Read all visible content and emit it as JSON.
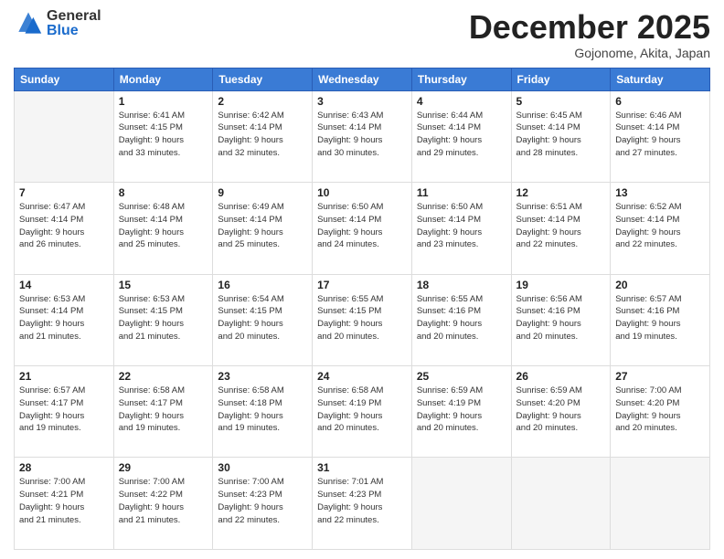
{
  "header": {
    "logo_general": "General",
    "logo_blue": "Blue",
    "month_title": "December 2025",
    "location": "Gojonome, Akita, Japan"
  },
  "days_of_week": [
    "Sunday",
    "Monday",
    "Tuesday",
    "Wednesday",
    "Thursday",
    "Friday",
    "Saturday"
  ],
  "weeks": [
    [
      {
        "day": "",
        "info": []
      },
      {
        "day": "1",
        "info": [
          "Sunrise: 6:41 AM",
          "Sunset: 4:15 PM",
          "Daylight: 9 hours",
          "and 33 minutes."
        ]
      },
      {
        "day": "2",
        "info": [
          "Sunrise: 6:42 AM",
          "Sunset: 4:14 PM",
          "Daylight: 9 hours",
          "and 32 minutes."
        ]
      },
      {
        "day": "3",
        "info": [
          "Sunrise: 6:43 AM",
          "Sunset: 4:14 PM",
          "Daylight: 9 hours",
          "and 30 minutes."
        ]
      },
      {
        "day": "4",
        "info": [
          "Sunrise: 6:44 AM",
          "Sunset: 4:14 PM",
          "Daylight: 9 hours",
          "and 29 minutes."
        ]
      },
      {
        "day": "5",
        "info": [
          "Sunrise: 6:45 AM",
          "Sunset: 4:14 PM",
          "Daylight: 9 hours",
          "and 28 minutes."
        ]
      },
      {
        "day": "6",
        "info": [
          "Sunrise: 6:46 AM",
          "Sunset: 4:14 PM",
          "Daylight: 9 hours",
          "and 27 minutes."
        ]
      }
    ],
    [
      {
        "day": "7",
        "info": [
          "Sunrise: 6:47 AM",
          "Sunset: 4:14 PM",
          "Daylight: 9 hours",
          "and 26 minutes."
        ]
      },
      {
        "day": "8",
        "info": [
          "Sunrise: 6:48 AM",
          "Sunset: 4:14 PM",
          "Daylight: 9 hours",
          "and 25 minutes."
        ]
      },
      {
        "day": "9",
        "info": [
          "Sunrise: 6:49 AM",
          "Sunset: 4:14 PM",
          "Daylight: 9 hours",
          "and 25 minutes."
        ]
      },
      {
        "day": "10",
        "info": [
          "Sunrise: 6:50 AM",
          "Sunset: 4:14 PM",
          "Daylight: 9 hours",
          "and 24 minutes."
        ]
      },
      {
        "day": "11",
        "info": [
          "Sunrise: 6:50 AM",
          "Sunset: 4:14 PM",
          "Daylight: 9 hours",
          "and 23 minutes."
        ]
      },
      {
        "day": "12",
        "info": [
          "Sunrise: 6:51 AM",
          "Sunset: 4:14 PM",
          "Daylight: 9 hours",
          "and 22 minutes."
        ]
      },
      {
        "day": "13",
        "info": [
          "Sunrise: 6:52 AM",
          "Sunset: 4:14 PM",
          "Daylight: 9 hours",
          "and 22 minutes."
        ]
      }
    ],
    [
      {
        "day": "14",
        "info": [
          "Sunrise: 6:53 AM",
          "Sunset: 4:14 PM",
          "Daylight: 9 hours",
          "and 21 minutes."
        ]
      },
      {
        "day": "15",
        "info": [
          "Sunrise: 6:53 AM",
          "Sunset: 4:15 PM",
          "Daylight: 9 hours",
          "and 21 minutes."
        ]
      },
      {
        "day": "16",
        "info": [
          "Sunrise: 6:54 AM",
          "Sunset: 4:15 PM",
          "Daylight: 9 hours",
          "and 20 minutes."
        ]
      },
      {
        "day": "17",
        "info": [
          "Sunrise: 6:55 AM",
          "Sunset: 4:15 PM",
          "Daylight: 9 hours",
          "and 20 minutes."
        ]
      },
      {
        "day": "18",
        "info": [
          "Sunrise: 6:55 AM",
          "Sunset: 4:16 PM",
          "Daylight: 9 hours",
          "and 20 minutes."
        ]
      },
      {
        "day": "19",
        "info": [
          "Sunrise: 6:56 AM",
          "Sunset: 4:16 PM",
          "Daylight: 9 hours",
          "and 20 minutes."
        ]
      },
      {
        "day": "20",
        "info": [
          "Sunrise: 6:57 AM",
          "Sunset: 4:16 PM",
          "Daylight: 9 hours",
          "and 19 minutes."
        ]
      }
    ],
    [
      {
        "day": "21",
        "info": [
          "Sunrise: 6:57 AM",
          "Sunset: 4:17 PM",
          "Daylight: 9 hours",
          "and 19 minutes."
        ]
      },
      {
        "day": "22",
        "info": [
          "Sunrise: 6:58 AM",
          "Sunset: 4:17 PM",
          "Daylight: 9 hours",
          "and 19 minutes."
        ]
      },
      {
        "day": "23",
        "info": [
          "Sunrise: 6:58 AM",
          "Sunset: 4:18 PM",
          "Daylight: 9 hours",
          "and 19 minutes."
        ]
      },
      {
        "day": "24",
        "info": [
          "Sunrise: 6:58 AM",
          "Sunset: 4:19 PM",
          "Daylight: 9 hours",
          "and 20 minutes."
        ]
      },
      {
        "day": "25",
        "info": [
          "Sunrise: 6:59 AM",
          "Sunset: 4:19 PM",
          "Daylight: 9 hours",
          "and 20 minutes."
        ]
      },
      {
        "day": "26",
        "info": [
          "Sunrise: 6:59 AM",
          "Sunset: 4:20 PM",
          "Daylight: 9 hours",
          "and 20 minutes."
        ]
      },
      {
        "day": "27",
        "info": [
          "Sunrise: 7:00 AM",
          "Sunset: 4:20 PM",
          "Daylight: 9 hours",
          "and 20 minutes."
        ]
      }
    ],
    [
      {
        "day": "28",
        "info": [
          "Sunrise: 7:00 AM",
          "Sunset: 4:21 PM",
          "Daylight: 9 hours",
          "and 21 minutes."
        ]
      },
      {
        "day": "29",
        "info": [
          "Sunrise: 7:00 AM",
          "Sunset: 4:22 PM",
          "Daylight: 9 hours",
          "and 21 minutes."
        ]
      },
      {
        "day": "30",
        "info": [
          "Sunrise: 7:00 AM",
          "Sunset: 4:23 PM",
          "Daylight: 9 hours",
          "and 22 minutes."
        ]
      },
      {
        "day": "31",
        "info": [
          "Sunrise: 7:01 AM",
          "Sunset: 4:23 PM",
          "Daylight: 9 hours",
          "and 22 minutes."
        ]
      },
      {
        "day": "",
        "info": []
      },
      {
        "day": "",
        "info": []
      },
      {
        "day": "",
        "info": []
      }
    ]
  ]
}
